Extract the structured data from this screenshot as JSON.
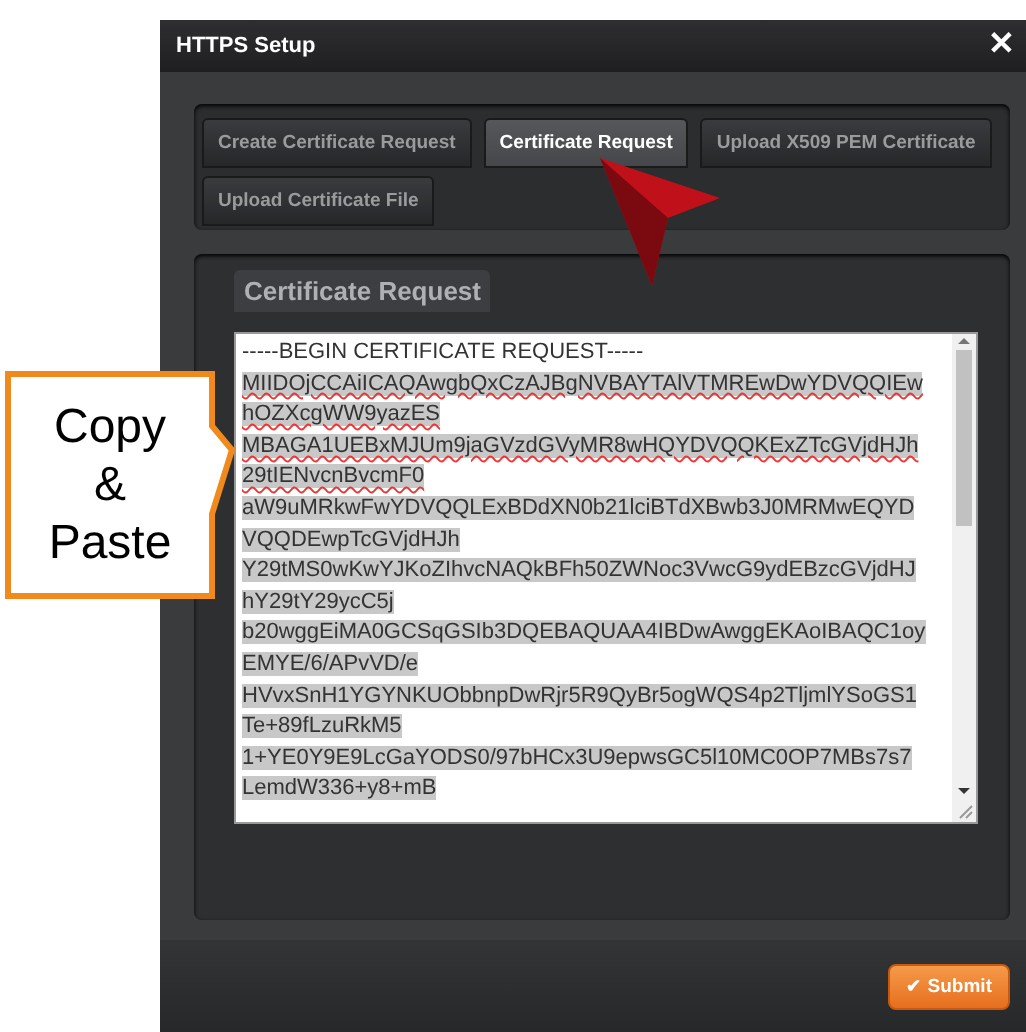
{
  "window": {
    "title": "HTTPS Setup",
    "close": "✕"
  },
  "tabs": [
    {
      "label": "Create Certificate Request",
      "selected": false
    },
    {
      "label": "Certificate Request",
      "selected": true
    },
    {
      "label": "Upload X509 PEM Certificate",
      "selected": false
    },
    {
      "label": "Upload Certificate File",
      "selected": false
    }
  ],
  "panel": {
    "title": "Certificate Request"
  },
  "certificate_lines": [
    {
      "text": "-----BEGIN CERTIFICATE REQUEST-----",
      "highlighted": false,
      "underlined": false
    },
    {
      "text": "MIIDOjCCAiICAQAwgbQxCzAJBgNVBAYTAlVTMREwDwYDVQQIEw",
      "highlighted": true,
      "underlined": true
    },
    {
      "text": "hOZXcgWW9yazES",
      "highlighted": true,
      "underlined": true
    },
    {
      "text": "MBAGA1UEBxMJUm9jaGVzdGVyMR8wHQYDVQQKExZTcGVjdHJh",
      "highlighted": true,
      "underlined": true
    },
    {
      "text": "29tIENvcnBvcmF0",
      "highlighted": true,
      "underlined": true
    },
    {
      "text": "aW9uMRkwFwYDVQQLExBDdXN0b21lciBTdXBwb3J0MRMwEQYD",
      "highlighted": true,
      "underlined": false
    },
    {
      "text": "VQQDEwpTcGVjdHJh",
      "highlighted": true,
      "underlined": false
    },
    {
      "text": "Y29tMS0wKwYJKoZIhvcNAQkBFh50ZWNoc3VwcG9ydEBzcGVjdHJ",
      "highlighted": true,
      "underlined": false
    },
    {
      "text": "hY29tY29ycC5j",
      "highlighted": true,
      "underlined": false
    },
    {
      "text": "b20wggEiMA0GCSqGSIb3DQEBAQUAA4IBDwAwggEKAoIBAQC1oy",
      "highlighted": true,
      "underlined": false
    },
    {
      "text": "EMYE/6/APvVD/e",
      "highlighted": true,
      "underlined": false
    },
    {
      "text": "HVvxSnH1YGYNKUObbnpDwRjr5R9QyBr5ogWQS4p2TljmlYSoGS1",
      "highlighted": true,
      "underlined": false
    },
    {
      "text": "Te+89fLzuRkM5",
      "highlighted": true,
      "underlined": false
    },
    {
      "text": "1+YE0Y9E9LcGaYODS0/97bHCx3U9epwsGC5l10MC0OP7MBs7s7",
      "highlighted": true,
      "underlined": false
    },
    {
      "text": "LemdW336+y8+mB",
      "highlighted": true,
      "underlined": false
    }
  ],
  "callout": {
    "lines": [
      "Copy",
      "&",
      "Paste"
    ]
  },
  "buttons": [
    {
      "label": "Submit",
      "icon": "✔"
    }
  ]
}
